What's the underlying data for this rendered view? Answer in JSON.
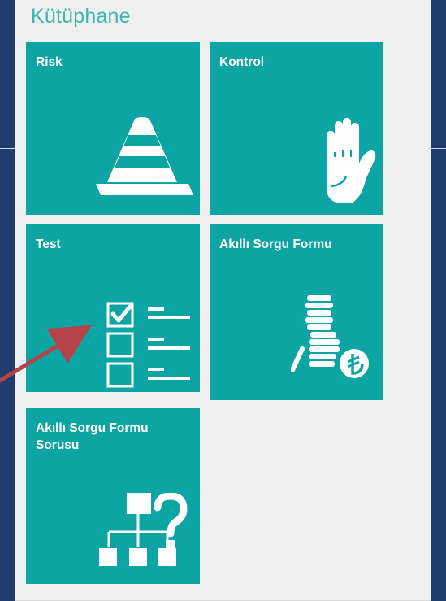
{
  "panel": {
    "title": "Kütüphane"
  },
  "tiles": [
    {
      "label": "Risk",
      "icon": "traffic-cone-icon"
    },
    {
      "label": "Kontrol",
      "icon": "hand-stop-icon"
    },
    {
      "label": "Test",
      "icon": "checklist-icon"
    },
    {
      "label": "Akıllı Sorgu Formu",
      "icon": "coin-stack-lira-icon"
    },
    {
      "label": "Akıllı Sorgu Formu Sorusu",
      "icon": "hierarchy-question-icon"
    }
  ],
  "colors": {
    "tile": "#0ca5a4",
    "panel": "#efefef",
    "background": "#1f3d6e",
    "title": "#39b7b0",
    "arrow": "#b6434a"
  }
}
